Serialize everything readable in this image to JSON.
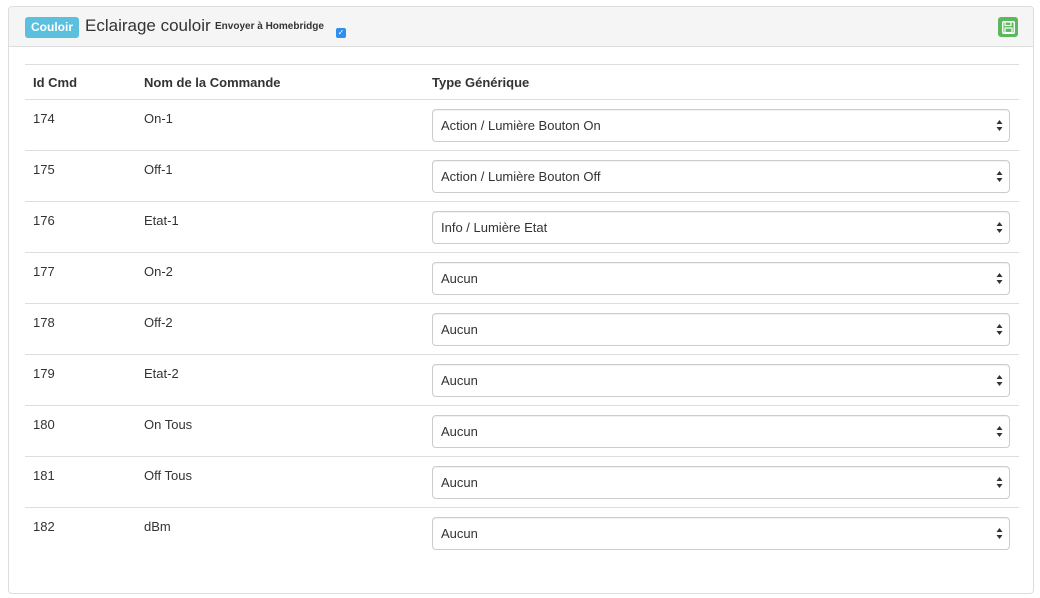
{
  "header": {
    "room_label": "Couloir",
    "equipment_name": "Eclairage couloir",
    "send_label": "Envoyer à Homebridge",
    "send_checked": true,
    "save_icon": "floppy-disk-icon",
    "room_color": "#5bc0de",
    "save_color": "#5cb85c"
  },
  "table": {
    "headers": {
      "id": "Id Cmd",
      "name": "Nom de la Commande",
      "type": "Type Générique"
    },
    "rows": [
      {
        "id": "174",
        "name": "On-1",
        "type": "Action / Lumière Bouton On"
      },
      {
        "id": "175",
        "name": "Off-1",
        "type": "Action / Lumière Bouton Off"
      },
      {
        "id": "176",
        "name": "Etat-1",
        "type": "Info / Lumière Etat"
      },
      {
        "id": "177",
        "name": "On-2",
        "type": "Aucun"
      },
      {
        "id": "178",
        "name": "Off-2",
        "type": "Aucun"
      },
      {
        "id": "179",
        "name": "Etat-2",
        "type": "Aucun"
      },
      {
        "id": "180",
        "name": "On Tous",
        "type": "Aucun"
      },
      {
        "id": "181",
        "name": "Off Tous",
        "type": "Aucun"
      },
      {
        "id": "182",
        "name": "dBm",
        "type": "Aucun"
      }
    ]
  }
}
